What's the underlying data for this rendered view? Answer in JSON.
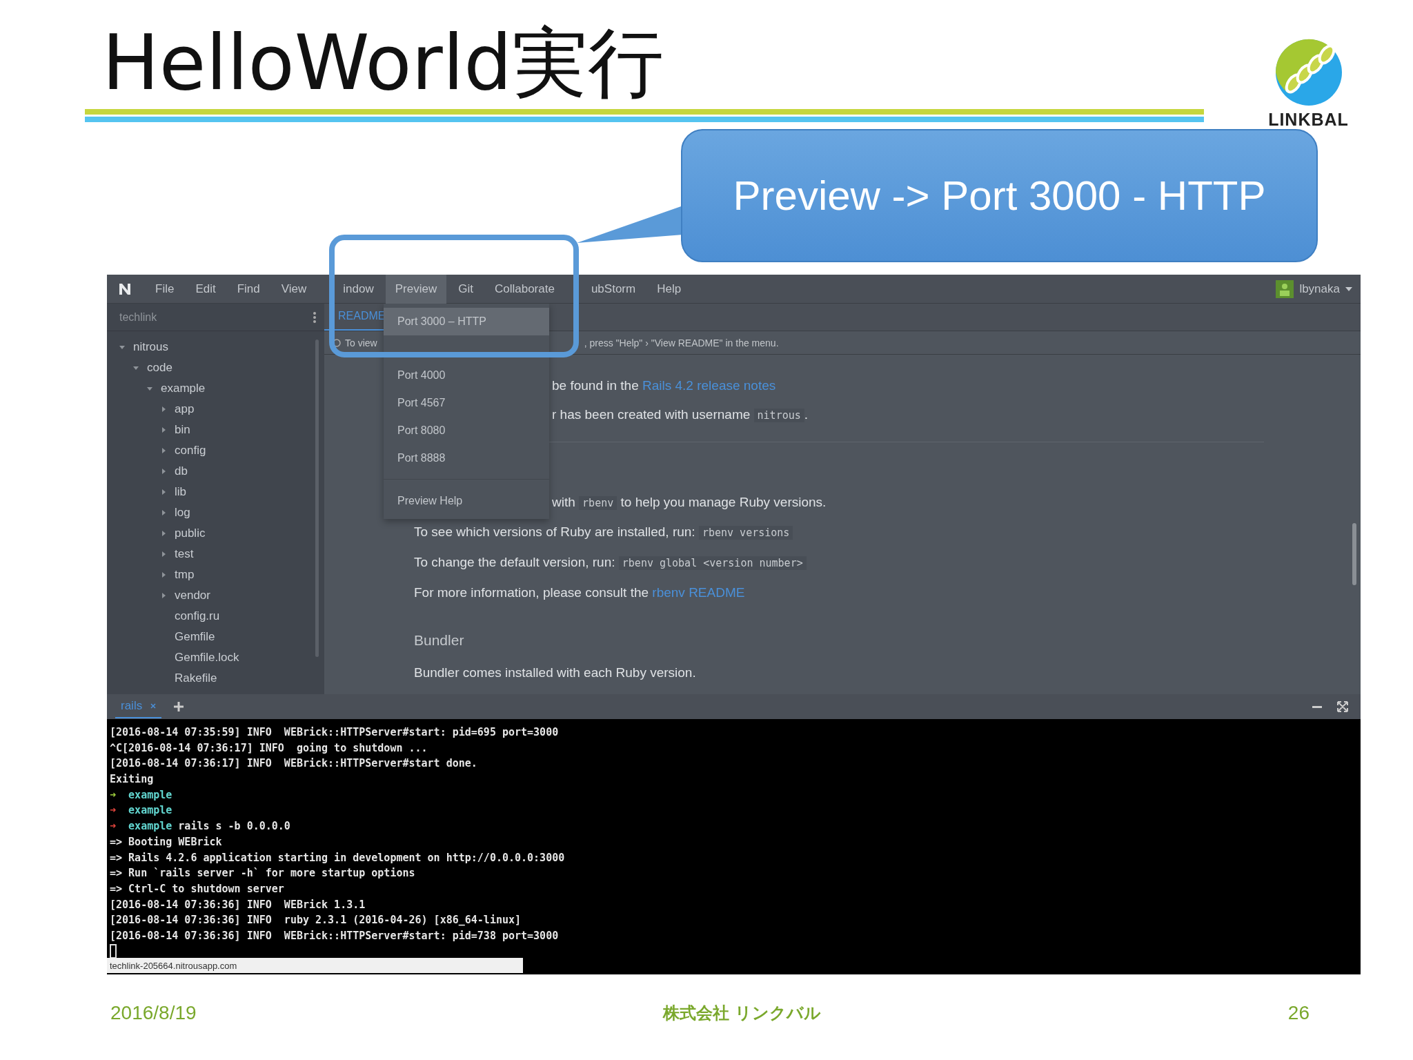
{
  "slide": {
    "title": "HelloWorld実行",
    "logo_text": "LINKBAL",
    "callout": "Preview -> Port 3000 - HTTP",
    "date": "2016/8/19",
    "company": "株式会社 リンクバル",
    "page": "26"
  },
  "ide": {
    "menu": [
      {
        "label": "File",
        "selected": false
      },
      {
        "label": "Edit",
        "selected": false
      },
      {
        "label": "Find",
        "selected": false
      },
      {
        "label": "View",
        "selected": false
      },
      {
        "label": "indow",
        "selected": false,
        "kind": "cut"
      },
      {
        "label": "Preview",
        "selected": true
      },
      {
        "label": "Git",
        "selected": false
      },
      {
        "label": "Collaborate",
        "selected": false
      },
      {
        "label": "ubStorm",
        "selected": false,
        "kind": "cut"
      },
      {
        "label": "Help",
        "selected": false
      }
    ],
    "user": "lbynaka",
    "project": "techlink",
    "tree": [
      {
        "kind": "folder",
        "name": "nitrous",
        "expanded": true,
        "children": [
          {
            "kind": "folder",
            "name": "code",
            "expanded": true,
            "children": [
              {
                "kind": "folder",
                "name": "example",
                "expanded": true,
                "children": [
                  {
                    "kind": "folder",
                    "name": "app",
                    "expanded": false
                  },
                  {
                    "kind": "folder",
                    "name": "bin",
                    "expanded": false
                  },
                  {
                    "kind": "folder",
                    "name": "config",
                    "expanded": false
                  },
                  {
                    "kind": "folder",
                    "name": "db",
                    "expanded": false
                  },
                  {
                    "kind": "folder",
                    "name": "lib",
                    "expanded": false
                  },
                  {
                    "kind": "folder",
                    "name": "log",
                    "expanded": false
                  },
                  {
                    "kind": "folder",
                    "name": "public",
                    "expanded": false
                  },
                  {
                    "kind": "folder",
                    "name": "test",
                    "expanded": false
                  },
                  {
                    "kind": "folder",
                    "name": "tmp",
                    "expanded": false
                  },
                  {
                    "kind": "folder",
                    "name": "vendor",
                    "expanded": false
                  },
                  {
                    "kind": "file",
                    "name": "config.ru"
                  },
                  {
                    "kind": "file",
                    "name": "Gemfile"
                  },
                  {
                    "kind": "file",
                    "name": "Gemfile.lock"
                  },
                  {
                    "kind": "file",
                    "name": "Rakefile"
                  }
                ]
              }
            ]
          }
        ]
      }
    ],
    "editor_tabs": [
      {
        "label": "README",
        "selected": true
      }
    ],
    "info_bar": {
      "left": "To view",
      "right": ", press \"Help\" › \"View README\" in the menu."
    },
    "dropdown": [
      [
        {
          "label": "Port 3000 – HTTP",
          "selected": true
        },
        {
          "label": "Port 4000",
          "selected": false
        },
        {
          "label": "Port 4567",
          "selected": false
        },
        {
          "label": "Port 8080",
          "selected": false
        },
        {
          "label": "Port 8888",
          "selected": false
        }
      ],
      [
        {
          "label": "Preview Help",
          "selected": false
        }
      ]
    ],
    "readme": [
      {
        "kind": "partial",
        "parts": [
          {
            "kind": "text",
            "text": "be found in the "
          },
          {
            "kind": "link",
            "text": "Rails 4.2 release notes"
          }
        ]
      },
      {
        "kind": "partial",
        "parts": [
          {
            "kind": "text",
            "text": "r has been created with username "
          },
          {
            "kind": "code",
            "text": "nitrous"
          },
          {
            "kind": "text",
            "text": "."
          }
        ]
      },
      {
        "kind": "rule"
      },
      {
        "kind": "partial",
        "parts": [
          {
            "kind": "text",
            "text": "with "
          },
          {
            "kind": "code",
            "text": "rbenv"
          },
          {
            "kind": "text",
            "text": " to help you manage Ruby versions."
          }
        ]
      },
      {
        "kind": "line",
        "parts": [
          {
            "kind": "text",
            "text": "To see which versions of Ruby are installed, run: "
          },
          {
            "kind": "code",
            "text": "rbenv versions"
          }
        ]
      },
      {
        "kind": "line",
        "parts": [
          {
            "kind": "text",
            "text": "To change the default version, run: "
          },
          {
            "kind": "code",
            "text": "rbenv global <version number>"
          }
        ]
      },
      {
        "kind": "line",
        "parts": [
          {
            "kind": "text",
            "text": "For more information, please consult the "
          },
          {
            "kind": "link",
            "text": "rbenv README"
          }
        ]
      },
      {
        "kind": "heading",
        "parts": [
          {
            "kind": "text",
            "text": "Bundler"
          }
        ]
      },
      {
        "kind": "line",
        "parts": [
          {
            "kind": "text",
            "text": "Bundler comes installed with each Ruby version."
          }
        ]
      }
    ],
    "terminal_tabs": [
      {
        "label": "rails",
        "selected": true
      }
    ],
    "terminal": [
      {
        "kind": "log",
        "text": "[2016-08-14 07:35:59] INFO  WEBrick::HTTPServer#start: pid=695 port=3000"
      },
      {
        "kind": "log",
        "text": "^C[2016-08-14 07:36:17] INFO  going to shutdown ..."
      },
      {
        "kind": "log",
        "text": "[2016-08-14 07:36:17] INFO  WEBrick::HTTPServer#start done."
      },
      {
        "kind": "log",
        "text": "Exiting"
      },
      {
        "kind": "prompt",
        "arrow": "➜",
        "color": "#9ccc3c",
        "dir": "example"
      },
      {
        "kind": "prompt",
        "arrow": "➜",
        "color": "#e0443c",
        "dir": "example"
      },
      {
        "kind": "prompt",
        "arrow": "➜",
        "color": "#e0443c",
        "dir": "example",
        "command": "rails s -b 0.0.0.0"
      },
      {
        "kind": "log",
        "text": "=> Booting WEBrick"
      },
      {
        "kind": "log",
        "text": "=> Rails 4.2.6 application starting in development on http://0.0.0.0:3000"
      },
      {
        "kind": "log",
        "text": "=> Run `rails server -h` for more startup options"
      },
      {
        "kind": "log",
        "text": "=> Ctrl-C to shutdown server"
      },
      {
        "kind": "log",
        "text": "[2016-08-14 07:36:36] INFO  WEBrick 1.3.1"
      },
      {
        "kind": "log",
        "text": "[2016-08-14 07:36:36] INFO  ruby 2.3.1 (2016-04-26) [x86_64-linux]"
      },
      {
        "kind": "log",
        "text": "[2016-08-14 07:36:36] INFO  WEBrick::HTTPServer#start: pid=738 port=3000"
      },
      {
        "kind": "cursor"
      }
    ],
    "status_url": "techlink-205664.nitrousapp.com"
  }
}
